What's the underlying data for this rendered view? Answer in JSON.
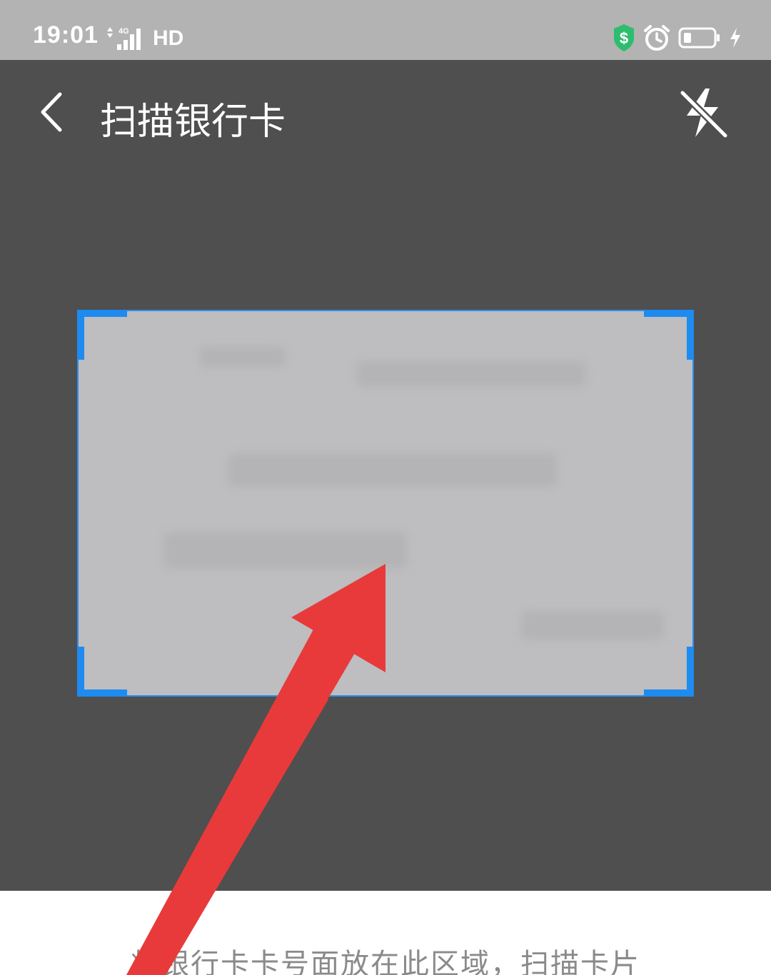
{
  "status_bar": {
    "time": "19:01",
    "network": "4G",
    "hd": "HD",
    "icons": [
      "data-arrows-icon",
      "signal-icon",
      "security-shield-icon",
      "alarm-icon",
      "battery-icon",
      "charging-icon"
    ],
    "shield_color": "#2dbd6e"
  },
  "app_bar": {
    "title": "扫描银行卡",
    "back_icon": "chevron-left-icon",
    "flash_icon": "flash-off-icon"
  },
  "scan_frame": {
    "accent_color": "#1e8bf0"
  },
  "hint": {
    "text": "将银行卡卡号面放在此区域，扫描卡片"
  },
  "annotation": {
    "arrow_color": "#e83a3a"
  }
}
